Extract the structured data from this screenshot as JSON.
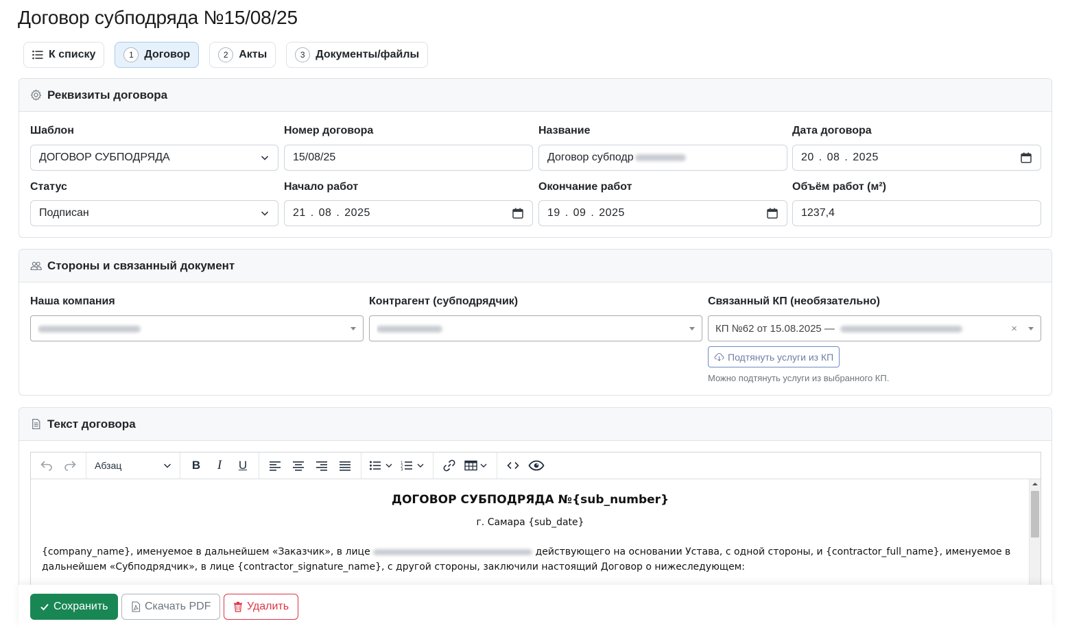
{
  "page": {
    "title": "Договор субподряда №15/08/25"
  },
  "tabs": [
    {
      "label": "К списку",
      "icon": "list-icon"
    },
    {
      "num": "1",
      "label": "Договор",
      "active": true
    },
    {
      "num": "2",
      "label": "Акты"
    },
    {
      "num": "3",
      "label": "Документы/файлы"
    }
  ],
  "requisites": {
    "header": "Реквизиты договора",
    "template": {
      "label": "Шаблон",
      "value": "ДОГОВОР СУБПОДРЯДА"
    },
    "number": {
      "label": "Номер договора",
      "value": "15/08/25"
    },
    "name": {
      "label": "Название",
      "value": "Договор субподр"
    },
    "date": {
      "label": "Дата договора",
      "value": "20 . 08 . 2025"
    },
    "status": {
      "label": "Статус",
      "value": "Подписан"
    },
    "start": {
      "label": "Начало работ",
      "value": "21 . 08 . 2025"
    },
    "end": {
      "label": "Окончание работ",
      "value": "19 . 09 . 2025"
    },
    "volume": {
      "label": "Объём работ (м²)",
      "value": "1237,4"
    }
  },
  "parties": {
    "header": "Стороны и связанный документ",
    "company": {
      "label": "Наша компания"
    },
    "contractor": {
      "label": "Контрагент (субподрядчик)"
    },
    "kp": {
      "label": "Связанный КП (необязательно)",
      "value": "КП №62 от 15.08.2025 —",
      "clear": "×"
    },
    "pull_button": "Подтянуть услуги из КП",
    "hint": "Можно подтянуть услуги из выбранного КП."
  },
  "contract_text": {
    "header": "Текст договора",
    "toolbar": {
      "block_format": "Абзац"
    },
    "doc_title": "ДОГОВОР СУБПОДРЯДА №{sub_number}",
    "doc_city": "г. Самара  {sub_date}",
    "para_part1": "{company_name}, именуемое в дальнейшем «Заказчик», в лице",
    "para_part2": "действующего на основании Устава, с одной стороны, и {contractor_full_name}, именуемое в дальнейшем «Субподрядчик», в лице {contractor_signature_name}, с другой стороны, заключили настоящий Договор о нижеследующем:"
  },
  "footer": {
    "save": "Сохранить",
    "pdf": "Скачать PDF",
    "delete": "Удалить"
  },
  "colors": {
    "primary": "#198754",
    "danger": "#dc3545",
    "active_tab_bg": "#e7f1fb"
  }
}
